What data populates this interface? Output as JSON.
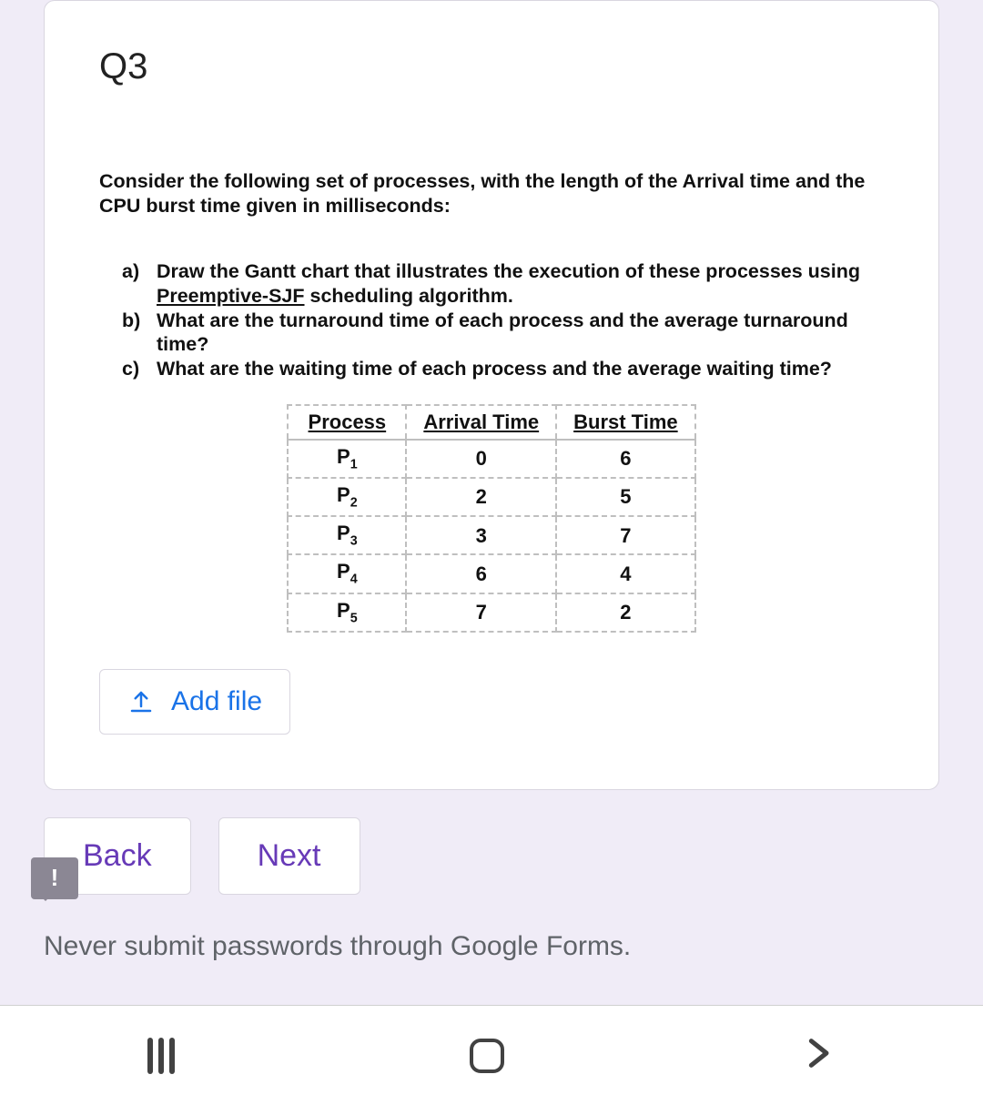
{
  "question": {
    "title": "Q3",
    "intro": "Consider the following set of processes, with the length of the Arrival time and the CPU burst time given in milliseconds:",
    "parts": {
      "a": {
        "marker": "a)",
        "before": "Draw the Gantt chart that illustrates the execution of these processes using ",
        "algo": "Preemptive-SJF",
        "after": " scheduling algorithm."
      },
      "b": {
        "marker": "b)",
        "text": "What are the turnaround time of each process and the average turnaround time?"
      },
      "c": {
        "marker": "c)",
        "text": "What are the waiting time of each process and the average waiting time?"
      }
    },
    "table": {
      "headers": {
        "process": "Process",
        "arrival": "Arrival Time",
        "burst": "Burst Time"
      },
      "rows": [
        {
          "p_base": "P",
          "p_sub": "1",
          "arrival": "0",
          "burst": "6"
        },
        {
          "p_base": "P",
          "p_sub": "2",
          "arrival": "2",
          "burst": "5"
        },
        {
          "p_base": "P",
          "p_sub": "3",
          "arrival": "3",
          "burst": "7"
        },
        {
          "p_base": "P",
          "p_sub": "4",
          "arrival": "6",
          "burst": "4"
        },
        {
          "p_base": "P",
          "p_sub": "5",
          "arrival": "7",
          "burst": "2"
        }
      ]
    }
  },
  "buttons": {
    "add_file": "Add file",
    "back": "Back",
    "next": "Next"
  },
  "report_icon_char": "!",
  "disclaimer": "Never submit passwords through Google Forms."
}
